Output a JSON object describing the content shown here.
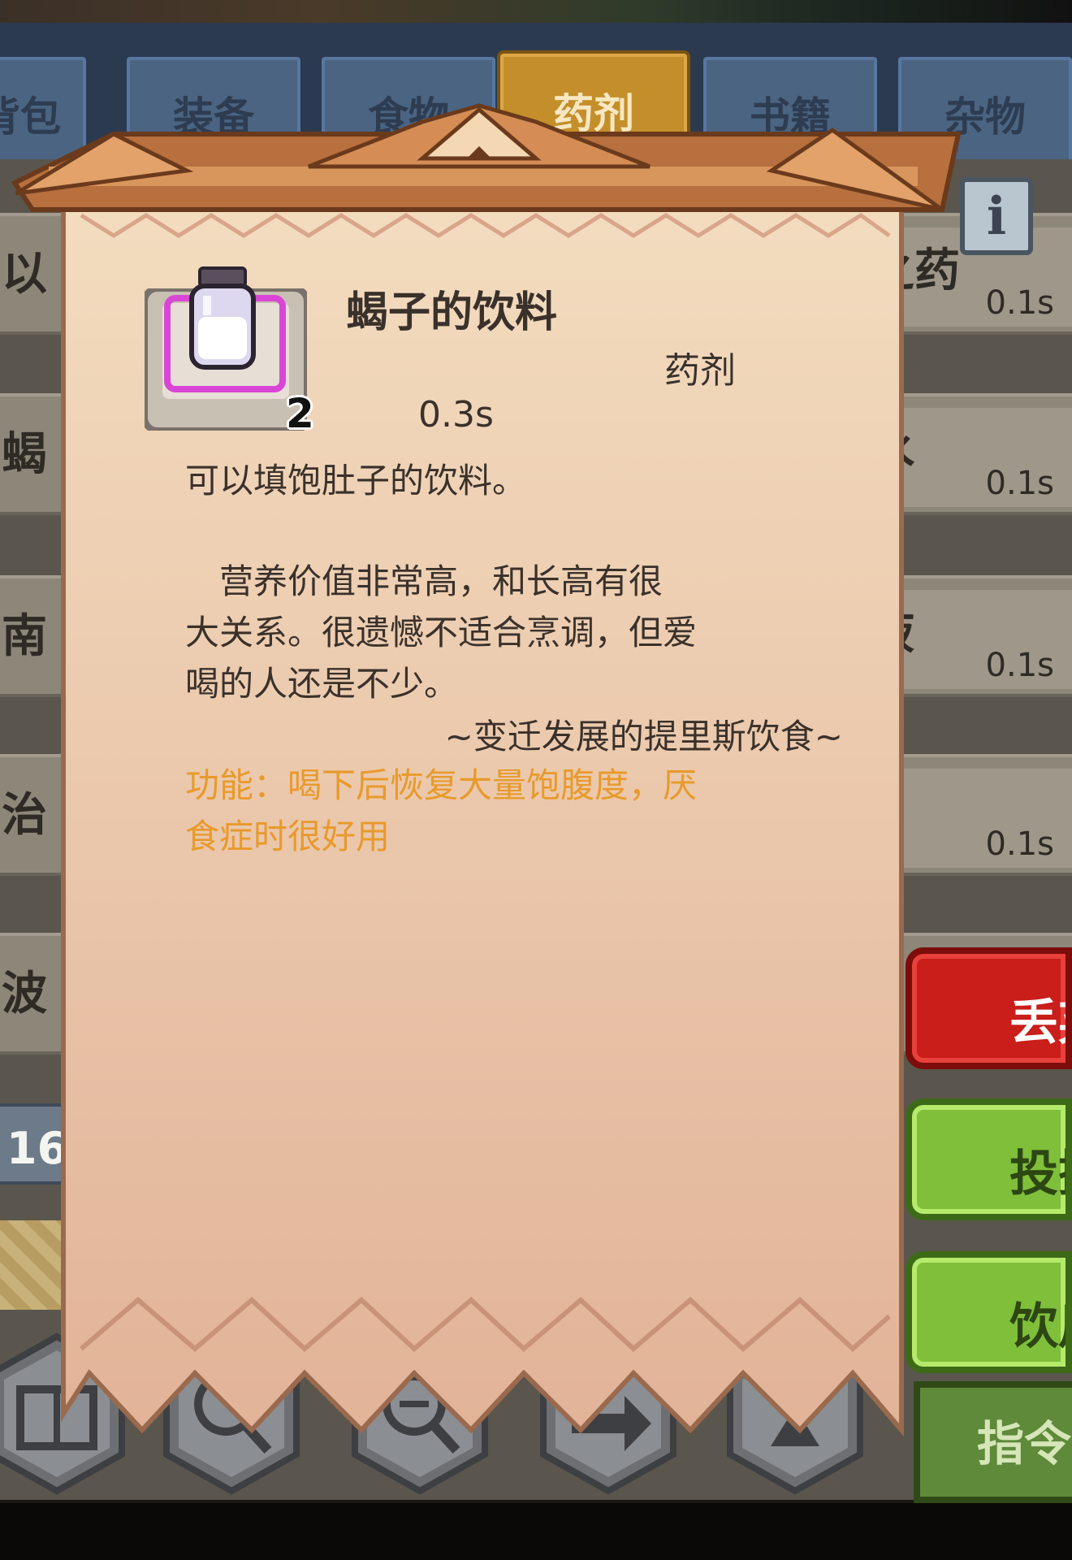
{
  "tabs": [
    {
      "label": "背包"
    },
    {
      "label": "装备"
    },
    {
      "label": "食物"
    },
    {
      "label": "药剂",
      "active": true
    },
    {
      "label": "书籍"
    },
    {
      "label": "杂物"
    }
  ],
  "list_rows": [
    {
      "name_partial": "以",
      "right_name": "之药",
      "right_time": "0.1s"
    },
    {
      "name_partial": "蝎",
      "right_name": "水",
      "right_time": "0.1s"
    },
    {
      "name_partial": "南",
      "right_name": "液",
      "right_time": "0.1s"
    },
    {
      "name_partial": "治",
      "right_name": "",
      "right_time": "0.1s"
    },
    {
      "name_partial": "波",
      "right_name": "",
      "right_time": ""
    }
  ],
  "list_count": "16",
  "item": {
    "name": "蝎子的饮料",
    "category": "药剂",
    "time": "0.3s",
    "count": "2",
    "summary": "可以填饱肚子的饮料。",
    "flavor_lines": [
      "　营养价值非常高，和长高有很",
      "大关系。很遗憾不适合烹调，但爱",
      "喝的人还是不少。"
    ],
    "quote": "~变迁发展的提里斯饮食~",
    "function_lines": [
      "功能：喝下后恢复大量饱腹度，厌",
      "食症时很好用"
    ]
  },
  "side_buttons": {
    "discard": "丢弃",
    "throw": "投掷",
    "drink": "饮用",
    "command": "指令"
  },
  "info_icon": "info-icon",
  "hex_icons": [
    "book-icon",
    "magnify-plus-icon",
    "magnify-minus-icon",
    "swap-arrow-icon",
    "hourglass-icon"
  ],
  "colors": {
    "parchment_top": "#f3dcbf",
    "parchment_bottom": "#e4b69a",
    "function_text": "#e89a2b",
    "active_tab": "#c48f2a",
    "rarity_border": "#d946d6",
    "discard_button": "#c91e1a",
    "action_button": "#7fbf3a"
  }
}
